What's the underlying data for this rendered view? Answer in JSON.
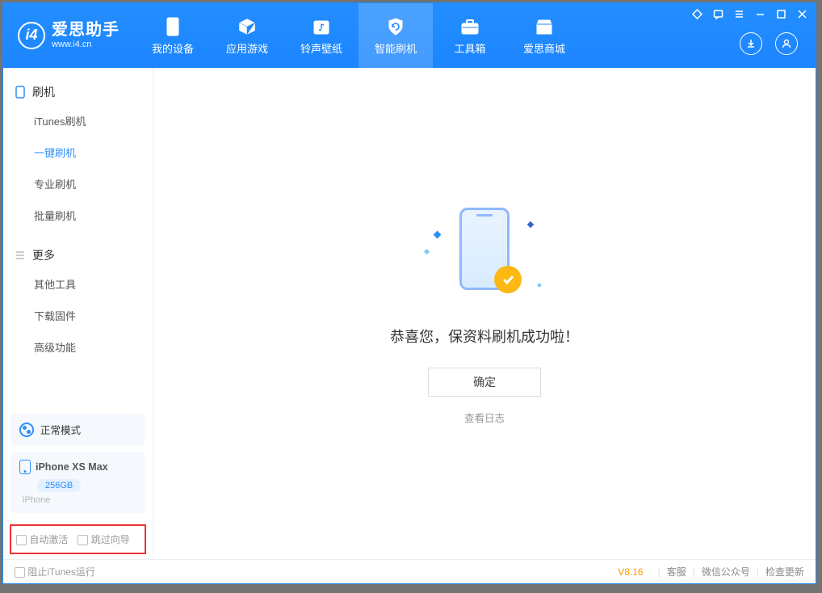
{
  "app": {
    "title": "爱思助手",
    "subtitle": "www.i4.cn"
  },
  "nav": {
    "tabs": [
      {
        "label": "我的设备"
      },
      {
        "label": "应用游戏"
      },
      {
        "label": "铃声壁纸"
      },
      {
        "label": "智能刷机"
      },
      {
        "label": "工具箱"
      },
      {
        "label": "爱思商城"
      }
    ]
  },
  "sidebar": {
    "section1": {
      "title": "刷机",
      "items": [
        "iTunes刷机",
        "一键刷机",
        "专业刷机",
        "批量刷机"
      ]
    },
    "section2": {
      "title": "更多",
      "items": [
        "其他工具",
        "下载固件",
        "高级功能"
      ]
    },
    "status_mode": "正常模式",
    "device": {
      "name": "iPhone XS Max",
      "capacity": "256GB",
      "type": "iPhone"
    },
    "checks": {
      "auto_activate": "自动激活",
      "skip_guide": "跳过向导"
    }
  },
  "main": {
    "success_message": "恭喜您，保资料刷机成功啦！",
    "ok_label": "确定",
    "view_log": "查看日志"
  },
  "footer": {
    "block_itunes": "阻止iTunes运行",
    "version": "V8.16",
    "links": [
      "客服",
      "微信公众号",
      "检查更新"
    ]
  }
}
